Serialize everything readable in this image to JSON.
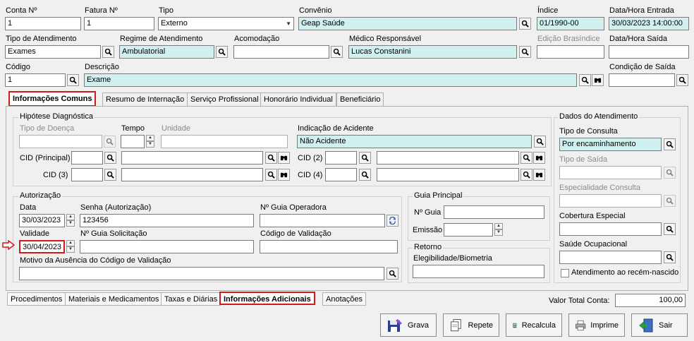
{
  "header": {
    "conta_label": "Conta Nº",
    "conta_value": "1",
    "fatura_label": "Fatura Nº",
    "fatura_value": "1",
    "tipo_label": "Tipo",
    "tipo_value": "Externo",
    "convenio_label": "Convênio",
    "convenio_value": "Geap Saúde",
    "indice_label": "Índice",
    "indice_value": "01/1990-00",
    "entrada_label": "Data/Hora Entrada",
    "entrada_value": "30/03/2023 14:00:00",
    "atendimento_label": "Tipo de Atendimento",
    "atendimento_value": "Exames",
    "regime_label": "Regime de Atendimento",
    "regime_value": "Ambulatorial",
    "acomodacao_label": "Acomodação",
    "acomodacao_value": "",
    "medico_label": "Médico Responsável",
    "medico_value": "Lucas Constanini",
    "edicao_label": "Edição Brasíndice",
    "edicao_value": "",
    "saida_label": "Data/Hora Saída",
    "saida_value": "",
    "codigo_label": "Código",
    "codigo_value": "1",
    "descricao_label": "Descrição",
    "descricao_value": "Exame",
    "condicao_label": "Condição de Saída",
    "condicao_value": ""
  },
  "tabs": [
    {
      "label": "Informações Comuns"
    },
    {
      "label": "Resumo de Internação"
    },
    {
      "label": "Serviço Profissional"
    },
    {
      "label": "Honorário Individual"
    },
    {
      "label": "Beneficiário"
    }
  ],
  "hipotese": {
    "title": "Hipótese Diagnóstica",
    "tipo_doenca_label": "Tipo de Doença",
    "tempo_label": "Tempo",
    "unidade_label": "Unidade",
    "acidente_label": "Indicação de Acidente",
    "acidente_value": "Não Acidente",
    "cid_principal_label": "CID (Principal)",
    "cid2_label": "CID (2)",
    "cid3_label": "CID (3)",
    "cid4_label": "CID (4)"
  },
  "autorizacao": {
    "title": "Autorização",
    "data_label": "Data",
    "data_value": "30/03/2023",
    "senha_label": "Senha (Autorização)",
    "senha_value": "123456",
    "guia_op_label": "Nº Guia Operadora",
    "guia_op_value": "",
    "validade_label": "Validade",
    "validade_value": "30/04/2023",
    "guia_sol_label": "Nº Guia Solicitação",
    "guia_sol_value": "",
    "cod_val_label": "Código de Validação",
    "cod_val_value": "",
    "motivo_label": "Motivo da Ausência do Código de Validação",
    "motivo_value": ""
  },
  "guia_principal": {
    "title": "Guia Principal",
    "guia_label": "Nº Guia",
    "emissao_label": "Emissão"
  },
  "retorno": {
    "title": "Retorno",
    "elegibilidade_label": "Elegibilidade/Biometria"
  },
  "dados": {
    "title": "Dados do Atendimento",
    "tipo_consulta_label": "Tipo de Consulta",
    "tipo_consulta_value": "Por encaminhamento",
    "tipo_saida_label": "Tipo de Saída",
    "especialidade_label": "Especialidade Consulta",
    "cobertura_label": "Cobertura Especial",
    "saude_label": "Saúde Ocupacional",
    "recem_label": "Atendimento ao recém-nascido"
  },
  "bottom_tabs": [
    {
      "label": "Procedimentos"
    },
    {
      "label": "Materiais e Medicamentos"
    },
    {
      "label": "Taxas e Diárias"
    },
    {
      "label": "Informações Adicionais"
    },
    {
      "label": "Anotações"
    }
  ],
  "total": {
    "label": "Valor Total Conta:",
    "value": "100,00"
  },
  "actions": {
    "grava": "Grava",
    "repete": "Repete",
    "recalcula": "Recalcula",
    "imprime": "Imprime",
    "sair": "Sair"
  },
  "colors": {
    "cyan_field": "#d1f0f0",
    "highlight": "#d21a1a"
  }
}
